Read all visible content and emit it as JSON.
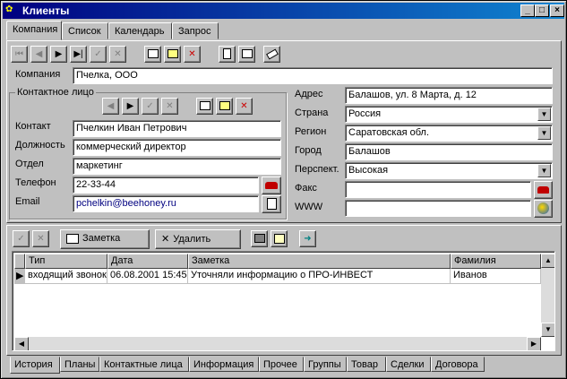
{
  "window": {
    "title": "Клиенты",
    "minimize": "_",
    "maximize": "□",
    "close": "×"
  },
  "tabs": [
    {
      "label": "Компания",
      "active": true
    },
    {
      "label": "Список"
    },
    {
      "label": "Календарь"
    },
    {
      "label": "Запрос"
    }
  ],
  "company": {
    "label": "Компания",
    "value": "Пчелка, ООО"
  },
  "contact_group": {
    "title": "Контактное лицо",
    "contact": {
      "label": "Контакт",
      "value": "Пчелкин Иван Петрович"
    },
    "position": {
      "label": "Должность",
      "value": "коммерческий директор"
    },
    "department": {
      "label": "Отдел",
      "value": "маркетинг"
    },
    "phone": {
      "label": "Телефон",
      "value": "22-33-44"
    },
    "email": {
      "label": "Email",
      "value": "pchelkin@beehoney.ru"
    }
  },
  "address": {
    "address": {
      "label": "Адрес",
      "value": "Балашов, ул. 8 Марта, д. 12"
    },
    "country": {
      "label": "Страна",
      "value": "Россия"
    },
    "region": {
      "label": "Регион",
      "value": "Саратовская обл."
    },
    "city": {
      "label": "Город",
      "value": "Балашов"
    },
    "prospect": {
      "label": "Перспект.",
      "value": "Высокая"
    },
    "fax": {
      "label": "Факс",
      "value": ""
    },
    "www": {
      "label": "WWW",
      "value": ""
    }
  },
  "notes_toolbar": {
    "note_label": "Заметка",
    "delete_label": "Удалить"
  },
  "grid": {
    "columns": [
      "Тип",
      "Дата",
      "Заметка",
      "Фамилия"
    ],
    "rows": [
      [
        "входящий звонок",
        "06.08.2001 15:45",
        "Уточняли информацию о ПРО-ИНВЕСТ",
        "Иванов"
      ]
    ]
  },
  "bottom_tabs": [
    {
      "label": "История",
      "active": true
    },
    {
      "label": "Планы"
    },
    {
      "label": "Контактные лица"
    },
    {
      "label": "Информация"
    },
    {
      "label": "Прочее"
    },
    {
      "label": "Группы"
    },
    {
      "label": "Товар"
    },
    {
      "label": "Сделки"
    },
    {
      "label": "Договора"
    }
  ],
  "icons": {
    "first": "⏮",
    "prev": "◀",
    "next": "▶",
    "last": "▶|",
    "post": "✓",
    "cancel": "✕",
    "arrow_right": "➜",
    "dropdown": "▼",
    "scroll_up": "▲",
    "scroll_down": "▼",
    "scroll_left": "◀",
    "scroll_right": "▶"
  }
}
